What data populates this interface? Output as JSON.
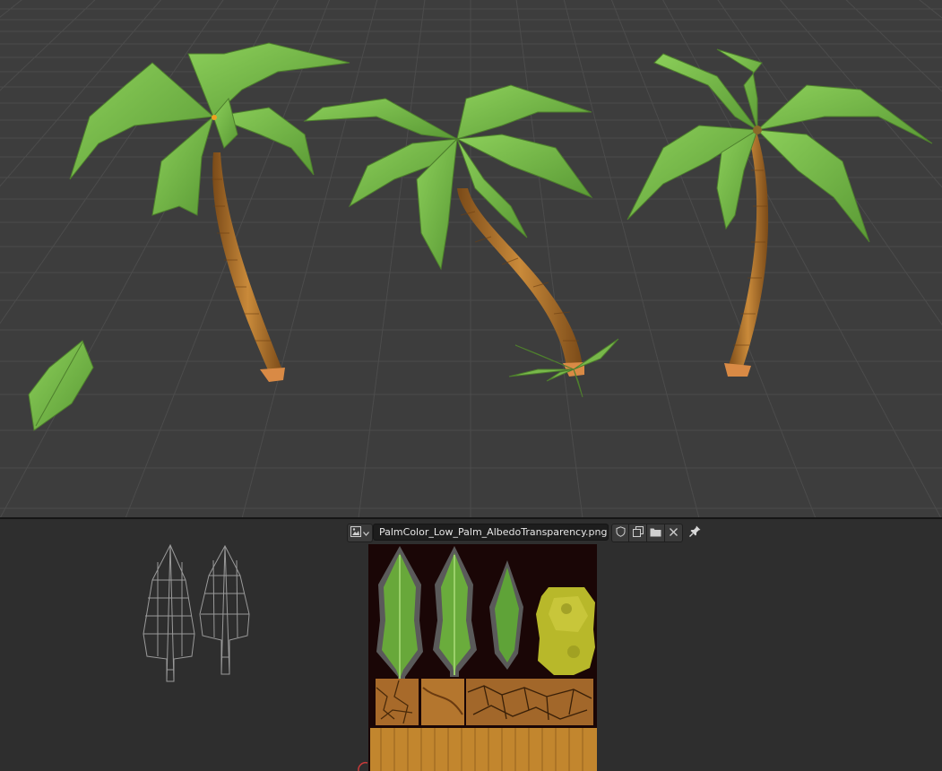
{
  "viewport_3d": {
    "objects": [
      "palm-tree-left",
      "palm-tree-center",
      "palm-tree-right",
      "loose-leaf",
      "ground-plant"
    ]
  },
  "uv_editor": {
    "image_name": "PalmColor_Low_Palm_AlbedoTransparency.png",
    "icons": {
      "image_type": "image-icon",
      "dropdown": "chevron-down-icon",
      "fake_user": "shield-icon",
      "duplicate": "duplicate-icon",
      "open": "folder-icon",
      "unlink": "close-icon",
      "pin": "pin-icon"
    }
  },
  "colors": {
    "viewport_bg": "#3d3d3d",
    "grid_line": "#4f4f4f",
    "leaf": "#7fbf4f",
    "trunk": "#b9772f",
    "texture_bg": "#1a0606"
  }
}
